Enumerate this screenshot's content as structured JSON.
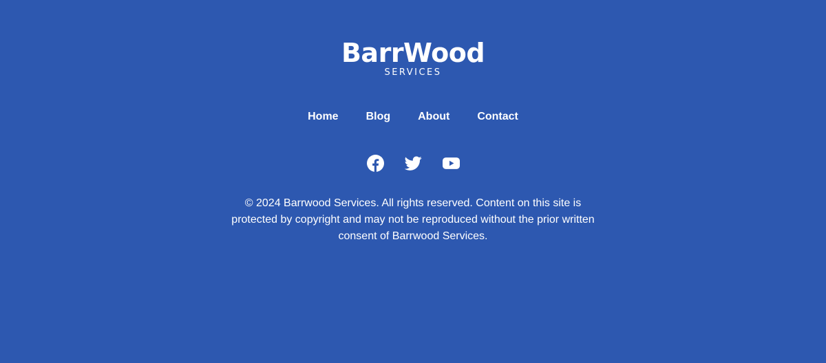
{
  "brand": {
    "name": "BarrWood",
    "tagline": "SERVICES"
  },
  "nav": {
    "items": [
      {
        "label": "Home"
      },
      {
        "label": "Blog"
      },
      {
        "label": "About"
      },
      {
        "label": "Contact"
      }
    ]
  },
  "social": {
    "icons": [
      "facebook-icon",
      "twitter-icon",
      "youtube-icon"
    ]
  },
  "footer": {
    "copyright": "© 2024 Barrwood Services. All rights reserved. Content on this site is protected by copyright and may not be reproduced without the prior written consent of Barrwood Services."
  },
  "colors": {
    "background": "#2d58b0",
    "text": "#ffffff"
  }
}
